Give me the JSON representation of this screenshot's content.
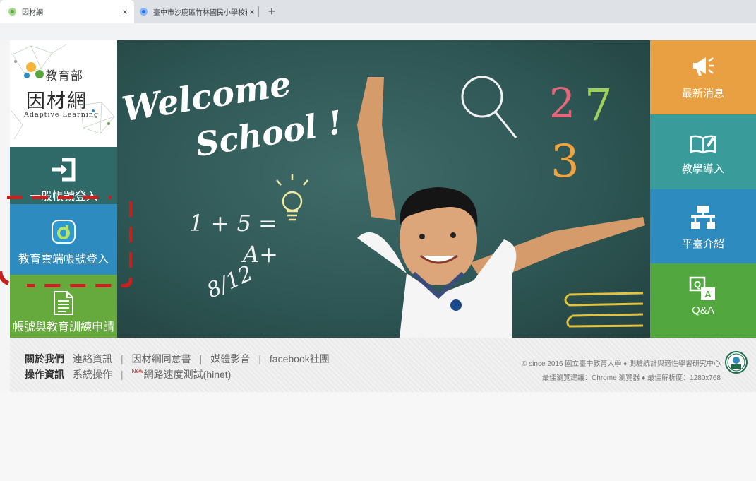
{
  "browser": {
    "active_tab": {
      "title": "因材網",
      "close": "×"
    },
    "inactive_tab": {
      "title": "臺中市沙鹿區竹林國民小學校務系",
      "close": "×"
    },
    "new_tab": "+"
  },
  "logo": {
    "ministry": "教育部",
    "name": "因材網",
    "subtitle": "Adaptive Learning"
  },
  "left_menu": {
    "login": "一般帳號登入",
    "cloud": "教育雲端帳號登入",
    "apply": "帳號與教育訓練申請"
  },
  "hero": {
    "line1": "Welcome",
    "line2": "School !",
    "chalk_math": "1 + 5 =",
    "chalk_grade": "A+",
    "chalk_fraction": "8/12",
    "chalk_nums": [
      "2",
      "7",
      "3"
    ]
  },
  "right_menu": {
    "news": "最新消息",
    "teaching": "教學導入",
    "platform": "平臺介紹",
    "qa": "Q&A"
  },
  "footer": {
    "row1_head": "關於我們",
    "row1_links": [
      "連絡資訊",
      "因材網同意書",
      "媒體影音",
      "facebook社團"
    ],
    "row2_head": "操作資訊",
    "row2_link1": "系統操作",
    "new_badge": "New",
    "row2_link2": "網路速度測試(hinet)",
    "copyright": "© since 2016 國立臺中教育大學 ♦ 測驗統計與適性學習研究中心",
    "browser_note": "最佳瀏覽建議：Chrome 瀏覽器 ♦ 最佳解析度：1280x768",
    "seal_label": "教育部"
  },
  "colors": {
    "news": "#e8a043",
    "teaching": "#3a9c9a",
    "platform": "#2e8bbf",
    "qa": "#52a83f",
    "login": "#2f6a68",
    "cloud": "#2e8bbf",
    "apply": "#66aa3d",
    "annotation": "#c4211f"
  }
}
